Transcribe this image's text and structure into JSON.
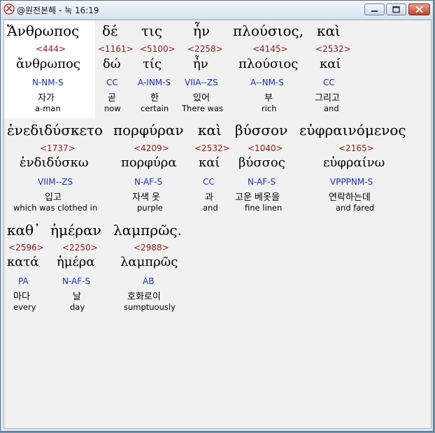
{
  "window": {
    "title": "@원전본해 - 눅 16:19"
  },
  "rows": [
    [
      {
        "greek": "Ἄνθρωπος",
        "strong": "<444>",
        "lemma": "ἄνθρωπος",
        "parse": "N-NM-S",
        "korean": "자가",
        "english": "a-man"
      },
      {
        "greek": "δέ",
        "strong": "<1161>",
        "lemma": "δώ",
        "parse": "CC",
        "korean": "곧",
        "english": "now"
      },
      {
        "greek": "τις",
        "strong": "<5100>",
        "lemma": "τίς",
        "parse": "A-INM-S",
        "korean": "한",
        "english": "certain"
      },
      {
        "greek": "ἦν",
        "strong": "<2258>",
        "lemma": "ἦν",
        "parse": "VIIA--ZS",
        "korean": "있어",
        "english": "There was"
      },
      {
        "greek": "πλούσιος,",
        "strong": "<4145>",
        "lemma": "πλούσιος",
        "parse": "A--NM-S",
        "korean": "부",
        "english": "rich"
      },
      {
        "greek": "καὶ",
        "strong": "<2532>",
        "lemma": "καί",
        "parse": "CC",
        "korean": "그리고",
        "english": "and"
      }
    ],
    [
      {
        "greek": "ἐνεδιδύσκετο",
        "strong": "<1737>",
        "lemma": "ἐνδιδύσκω",
        "parse": "VIIM--ZS",
        "korean": "입고",
        "english": "which was clothed in"
      },
      {
        "greek": "πορφύραν",
        "strong": "<4209>",
        "lemma": "πορφύρα",
        "parse": "N-AF-S",
        "korean": "자색 옷",
        "english": "purple"
      },
      {
        "greek": "καὶ",
        "strong": "<2532>",
        "lemma": "καί",
        "parse": "CC",
        "korean": "과",
        "english": "and"
      },
      {
        "greek": "βύσσον",
        "strong": "<1040>",
        "lemma": "βύσσος",
        "parse": "N-AF-S",
        "korean": "고운 베옷을",
        "english": "fine linen"
      },
      {
        "greek": "εὐφραινόμενος",
        "strong": "<2165>",
        "lemma": "εὐφραίνω",
        "parse": "VPPPNM-S",
        "korean": "연락하는데",
        "english": "and fared"
      }
    ],
    [
      {
        "greek": "καθ᾽",
        "strong": "<2596>",
        "lemma": "κατά",
        "parse": "PA",
        "korean": "마다",
        "english": "every"
      },
      {
        "greek": "ἡμέραν",
        "strong": "<2250>",
        "lemma": "ἡμέρα",
        "parse": "N-AF-S",
        "korean": "날",
        "english": "day"
      },
      {
        "greek": "λαμπρῶς.",
        "strong": "<2988>",
        "lemma": "λαμπρῶς",
        "parse": "AB",
        "korean": "호화로이",
        "english": "sumptuously"
      }
    ]
  ]
}
